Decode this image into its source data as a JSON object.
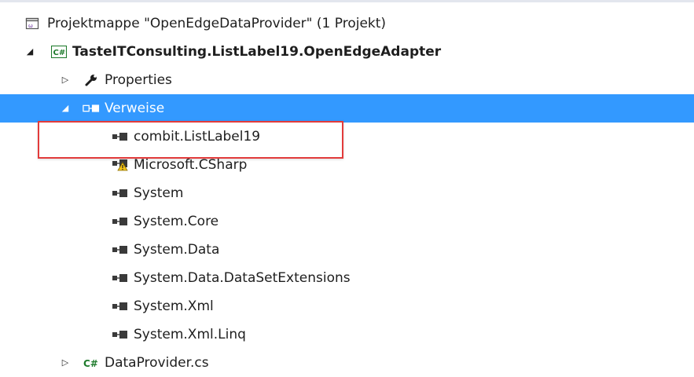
{
  "solution_explorer": {
    "solution": {
      "label": "Projektmappe \"OpenEdgeDataProvider\" (1 Projekt)",
      "icon": "solution-icon"
    },
    "project": {
      "label": "TasteITConsulting.ListLabel19.OpenEdgeAdapter",
      "icon": "csharp-project-icon",
      "expanded": true
    },
    "properties": {
      "label": "Properties",
      "icon": "wrench-icon",
      "expanded": false
    },
    "references": {
      "label": "Verweise",
      "icon": "references-icon",
      "expanded": true,
      "selected": true
    },
    "reference_items": [
      {
        "label": "combit.ListLabel19",
        "icon": "assembly-reference-icon",
        "highlighted": true
      },
      {
        "label": "Microsoft.CSharp",
        "icon": "assembly-reference-warning-icon",
        "warning": true
      },
      {
        "label": "System",
        "icon": "assembly-reference-icon"
      },
      {
        "label": "System.Core",
        "icon": "assembly-reference-icon"
      },
      {
        "label": "System.Data",
        "icon": "assembly-reference-icon"
      },
      {
        "label": "System.Data.DataSetExtensions",
        "icon": "assembly-reference-icon"
      },
      {
        "label": "System.Xml",
        "icon": "assembly-reference-icon"
      },
      {
        "label": "System.Xml.Linq",
        "icon": "assembly-reference-icon"
      }
    ],
    "file": {
      "label": "DataProvider.cs",
      "icon": "csharp-file-icon",
      "expanded": false
    },
    "colors": {
      "selection": "#3399ff",
      "highlight_border": "#e23b3b",
      "csharp_green": "#1e7b2c",
      "warning_yellow": "#f5c518"
    }
  }
}
